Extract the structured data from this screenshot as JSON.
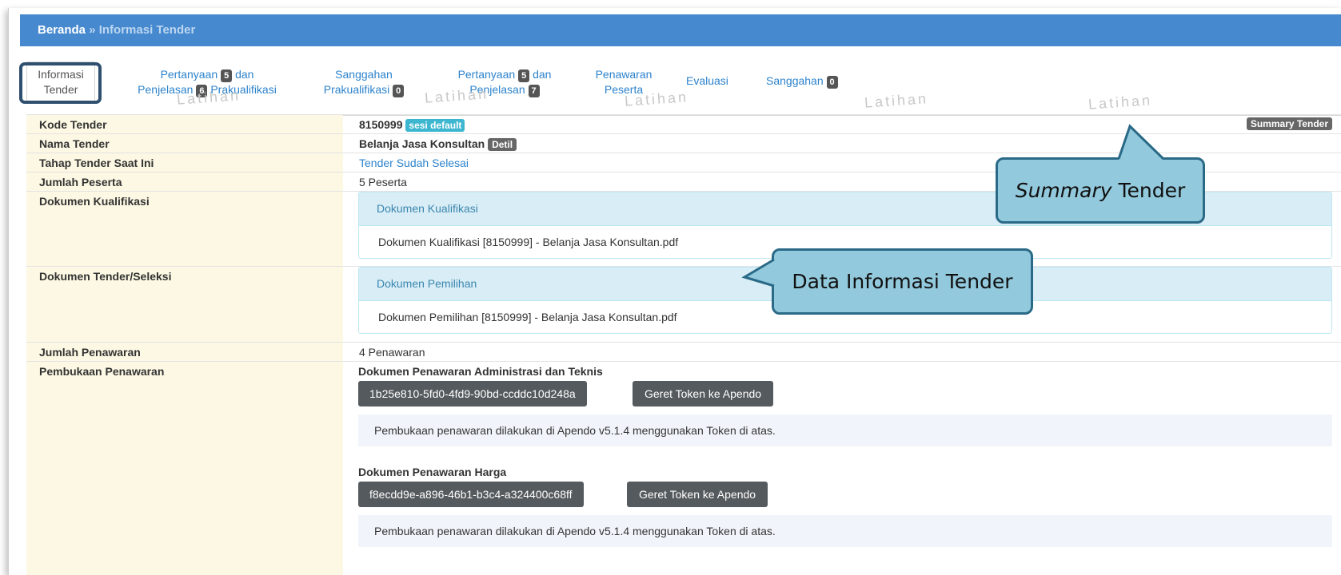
{
  "breadcrumb": {
    "home": "Beranda",
    "separator": "»",
    "current": "Informasi Tender"
  },
  "tabs": [
    {
      "line1": "Informasi",
      "line2": "Tender"
    },
    {
      "line1_text": "Pertanyaan",
      "line1_badge": "5",
      "line1_suffix": "dan",
      "line2_text": "Penjelasan",
      "line2_badge": "6",
      "line2_suffix": "Prakualifikasi"
    },
    {
      "line1": "Sanggahan",
      "line2_text": "Prakualifikasi",
      "line2_badge": "0"
    },
    {
      "line1_text": "Pertanyaan",
      "line1_badge": "5",
      "line1_suffix": "dan",
      "line2_text": "Penjelasan",
      "line2_badge": "7"
    },
    {
      "line1": "Penawaran",
      "line2": "Peserta"
    },
    {
      "line1": "Evaluasi"
    },
    {
      "label": "Sanggahan",
      "badge": "0"
    }
  ],
  "watermark": "Latihan",
  "rows": {
    "kode": {
      "label": "Kode Tender",
      "value": "8150999",
      "badge": "sesi default",
      "button": "Summary Tender"
    },
    "nama": {
      "label": "Nama Tender",
      "value": "Belanja Jasa Konsultan",
      "badge": "Detil"
    },
    "tahap": {
      "label": "Tahap Tender Saat Ini",
      "value": "Tender Sudah Selesai"
    },
    "peserta": {
      "label": "Jumlah Peserta",
      "value": "5 Peserta"
    },
    "kualifikasi": {
      "label": "Dokumen Kualifikasi",
      "panel_title": "Dokumen Kualifikasi",
      "file": "Dokumen Kualifikasi [8150999] - Belanja Jasa Konsultan.pdf"
    },
    "seleksi": {
      "label": "Dokumen Tender/Seleksi",
      "panel_title": "Dokumen Pemilihan",
      "file": "Dokumen Pemilihan [8150999] - Belanja Jasa Konsultan.pdf"
    },
    "penawaran": {
      "label": "Jumlah Penawaran",
      "value": "4 Penawaran"
    },
    "pembukaan": {
      "label": "Pembukaan Penawaran",
      "admin": {
        "title": "Dokumen Penawaran Administrasi dan Teknis",
        "token": "1b25e810-5fd0-4fd9-90bd-ccddc10d248a",
        "button": "Geret Token ke Apendo",
        "note": "Pembukaan penawaran dilakukan di Apendo v5.1.4 menggunakan Token di atas."
      },
      "harga": {
        "title": "Dokumen Penawaran Harga",
        "token": "f8ecdd9e-a896-46b1-b3c4-a324400c68ff",
        "button": "Geret Token ke Apendo",
        "note": "Pembukaan penawaran dilakukan di Apendo v5.1.4 menggunakan Token di atas."
      }
    }
  },
  "callouts": {
    "summary": {
      "italic": "Summary",
      "text": "Tender"
    },
    "data": {
      "text": "Data Informasi Tender"
    }
  },
  "colors": {
    "header": "#4689cf",
    "label_bg": "#fcf8e3",
    "link": "#2d83cc",
    "callout_fill": "#92c9dc",
    "callout_border": "#2a6a87"
  }
}
